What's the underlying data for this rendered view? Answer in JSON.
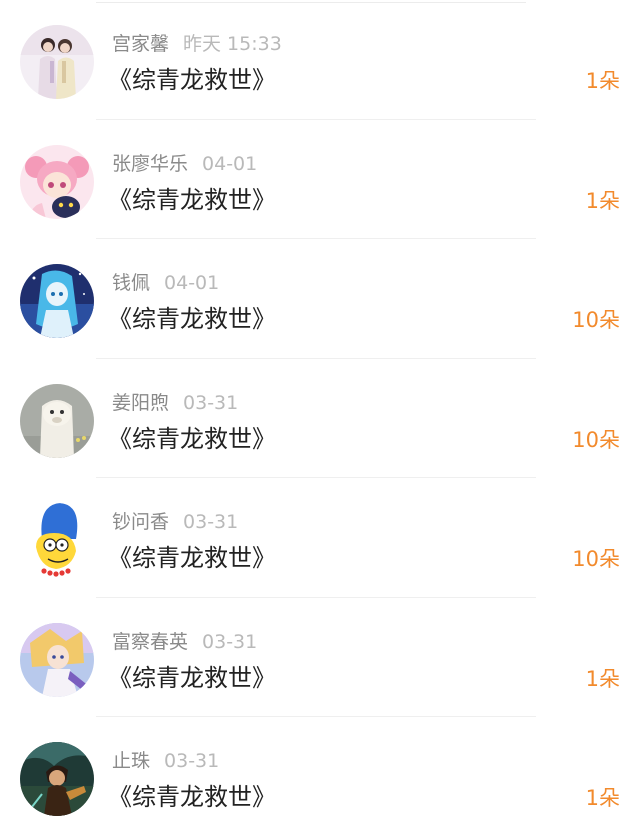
{
  "rows": [
    {
      "name": "宫家馨",
      "time": "昨天 15:33",
      "title": "《综青龙救世》",
      "amount": "1朵",
      "avatar": "avatar-couple"
    },
    {
      "name": "张廖华乐",
      "time": "04-01",
      "title": "《综青龙救世》",
      "amount": "1朵",
      "avatar": "avatar-sailor-moon"
    },
    {
      "name": "钱佩",
      "time": "04-01",
      "title": "《综青龙救世》",
      "amount": "10朵",
      "avatar": "avatar-blue-anime"
    },
    {
      "name": "姜阳煦",
      "time": "03-31",
      "title": "《综青龙救世》",
      "amount": "10朵",
      "avatar": "avatar-alpaca"
    },
    {
      "name": "钞问香",
      "time": "03-31",
      "title": "《综青龙救世》",
      "amount": "10朵",
      "avatar": "avatar-marge-simpson"
    },
    {
      "name": "富察春英",
      "time": "03-31",
      "title": "《综青龙救世》",
      "amount": "1朵",
      "avatar": "avatar-fantasy-anime"
    },
    {
      "name": "止珠",
      "time": "03-31",
      "title": "《综青龙救世》",
      "amount": "1朵",
      "avatar": "avatar-dark-anime"
    }
  ],
  "colors": {
    "amount": "#f28a2c",
    "name": "#8a8a8a",
    "time": "#b9b9b9",
    "title": "#222222"
  }
}
